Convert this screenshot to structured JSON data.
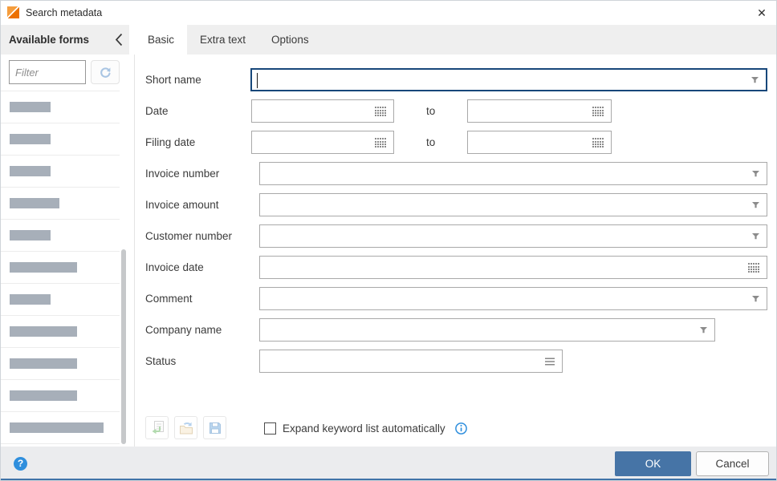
{
  "window": {
    "title": "Search metadata",
    "close_glyph": "✕"
  },
  "sidebar": {
    "header": "Available forms",
    "filter_placeholder": "Filter",
    "items": [
      {
        "placeholder_width": 51
      },
      {
        "placeholder_width": 51
      },
      {
        "placeholder_width": 51
      },
      {
        "placeholder_width": 62
      },
      {
        "placeholder_width": 51
      },
      {
        "placeholder_width": 84
      },
      {
        "placeholder_width": 51
      },
      {
        "placeholder_width": 84
      },
      {
        "placeholder_width": 84
      },
      {
        "placeholder_width": 84
      },
      {
        "placeholder_width": 117
      }
    ]
  },
  "tabs": [
    {
      "label": "Basic",
      "active": true
    },
    {
      "label": "Extra text",
      "active": false
    },
    {
      "label": "Options",
      "active": false
    }
  ],
  "form": {
    "to_label": "to",
    "rows": [
      {
        "label": "Short name",
        "control": "combo",
        "focused": true,
        "value": ""
      },
      {
        "label": "Date",
        "control": "daterange",
        "value_from": "",
        "value_to": ""
      },
      {
        "label": "Filing date",
        "control": "daterange",
        "value_from": "",
        "value_to": ""
      },
      {
        "label": "Invoice number",
        "control": "combo",
        "value": ""
      },
      {
        "label": "Invoice amount",
        "control": "combo",
        "value": ""
      },
      {
        "label": "Customer number",
        "control": "combo",
        "value": ""
      },
      {
        "label": "Invoice date",
        "control": "date",
        "value": ""
      },
      {
        "label": "Comment",
        "control": "combo",
        "value": ""
      },
      {
        "label": "Company name",
        "control": "combo",
        "value": ""
      },
      {
        "label": "Status",
        "control": "list",
        "value": ""
      }
    ]
  },
  "actions": {
    "buttons": [
      {
        "name": "apply-form-button",
        "icon": "apply-form-icon"
      },
      {
        "name": "load-template-button",
        "icon": "open-folder-icon"
      },
      {
        "name": "save-template-button",
        "icon": "save-icon"
      }
    ],
    "checkbox_label": "Expand keyword list automatically",
    "checkbox_checked": false
  },
  "footer": {
    "help_glyph": "?",
    "ok_label": "OK",
    "cancel_label": "Cancel"
  },
  "colors": {
    "accent_blue": "#4674a6",
    "focus_border": "#17477a",
    "info_blue": "#2f8fdd",
    "strip_gray": "#efefef",
    "footer_gray": "#ebecee",
    "placeholder_bar": "#a7afb9",
    "bottom_accent": "#4073a8"
  }
}
